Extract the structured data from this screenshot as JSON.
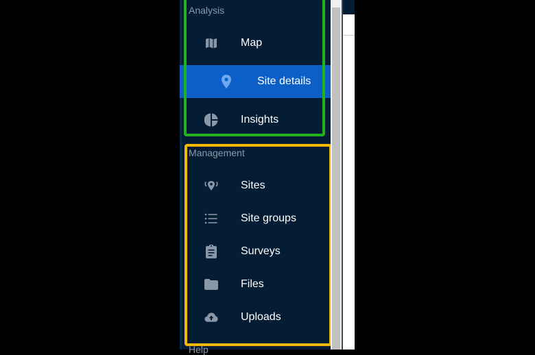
{
  "sidebar": {
    "sections": [
      {
        "title": "Analysis",
        "items": [
          {
            "label": "Map",
            "icon": "map-icon",
            "active": false
          },
          {
            "label": "Site details",
            "icon": "map-pin-icon",
            "active": true
          },
          {
            "label": "Insights",
            "icon": "pie-chart-icon",
            "active": false
          }
        ]
      },
      {
        "title": "Management",
        "items": [
          {
            "label": "Sites",
            "icon": "sites-pin-icon",
            "active": false
          },
          {
            "label": "Site groups",
            "icon": "list-icon",
            "active": false
          },
          {
            "label": "Surveys",
            "icon": "clipboard-icon",
            "active": false
          },
          {
            "label": "Files",
            "icon": "folder-icon",
            "active": false
          },
          {
            "label": "Uploads",
            "icon": "cloud-upload-icon",
            "active": false
          }
        ]
      },
      {
        "title": "Help"
      }
    ]
  },
  "colors": {
    "sidebar_bg": "#041c34",
    "active_bg": "#0b5fc7",
    "icon": "#8a97a6",
    "active_icon": "#6fa8f0",
    "highlight_green": "#1fb41f",
    "highlight_yellow": "#f5b800"
  }
}
